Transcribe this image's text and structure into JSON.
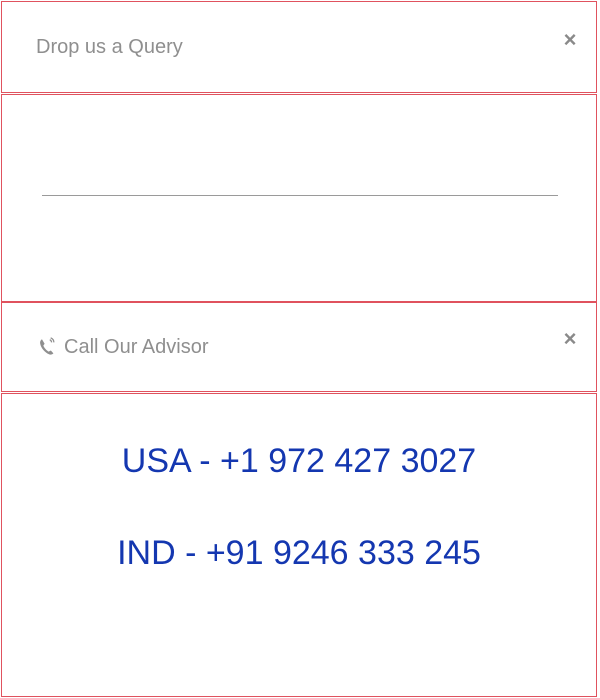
{
  "query_panel": {
    "title": "Drop us a Query",
    "close_label": "×",
    "input_value": ""
  },
  "advisor_panel": {
    "title": "Call Our Advisor",
    "close_label": "×",
    "phone_icon": "phone-icon",
    "phones": [
      "USA - +1 972 427 3027",
      "IND - +91 9246 333 245"
    ]
  },
  "colors": {
    "border": "#e0525e",
    "title_text": "#8f8f8f",
    "phone_text": "#1437b0"
  }
}
